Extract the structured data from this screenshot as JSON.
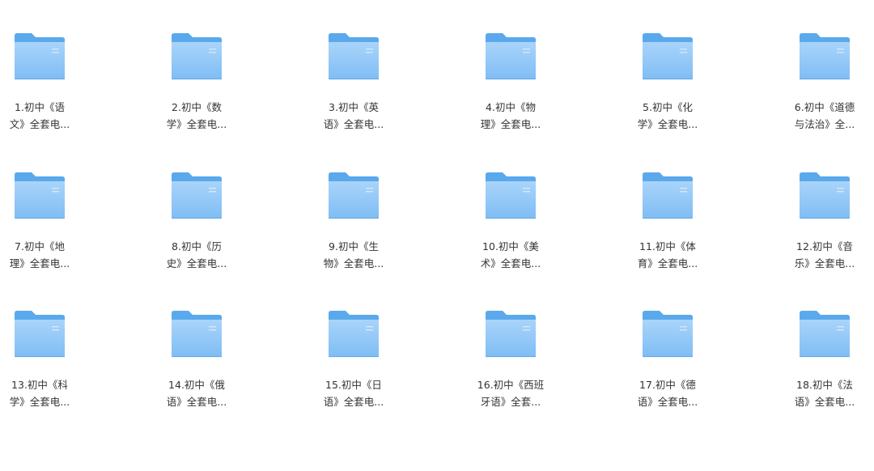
{
  "folders": [
    {
      "line1": "1.初中《语",
      "line2": "文》全套电..."
    },
    {
      "line1": "2.初中《数",
      "line2": "学》全套电..."
    },
    {
      "line1": "3.初中《英",
      "line2": "语》全套电..."
    },
    {
      "line1": "4.初中《物",
      "line2": "理》全套电..."
    },
    {
      "line1": "5.初中《化",
      "line2": "学》全套电..."
    },
    {
      "line1": "6.初中《道德",
      "line2": "与法治》全..."
    },
    {
      "line1": "7.初中《地",
      "line2": "理》全套电..."
    },
    {
      "line1": "8.初中《历",
      "line2": "史》全套电..."
    },
    {
      "line1": "9.初中《生",
      "line2": "物》全套电..."
    },
    {
      "line1": "10.初中《美",
      "line2": "术》全套电..."
    },
    {
      "line1": "11.初中《体",
      "line2": "育》全套电..."
    },
    {
      "line1": "12.初中《音",
      "line2": "乐》全套电..."
    },
    {
      "line1": "13.初中《科",
      "line2": "学》全套电..."
    },
    {
      "line1": "14.初中《俄",
      "line2": "语》全套电..."
    },
    {
      "line1": "15.初中《日",
      "line2": "语》全套电..."
    },
    {
      "line1": "16.初中《西班",
      "line2": "牙语》全套..."
    },
    {
      "line1": "17.初中《德",
      "line2": "语》全套电..."
    },
    {
      "line1": "18.初中《法",
      "line2": "语》全套电..."
    }
  ],
  "icons": {
    "folder": "folder-icon"
  },
  "colors": {
    "folder_back": "#5aa9ec",
    "folder_front_top": "#a9d4fa",
    "folder_front_bottom": "#7fbdf4",
    "folder_edge": "#4a98de",
    "label_text": "#333333",
    "background": "#ffffff"
  }
}
